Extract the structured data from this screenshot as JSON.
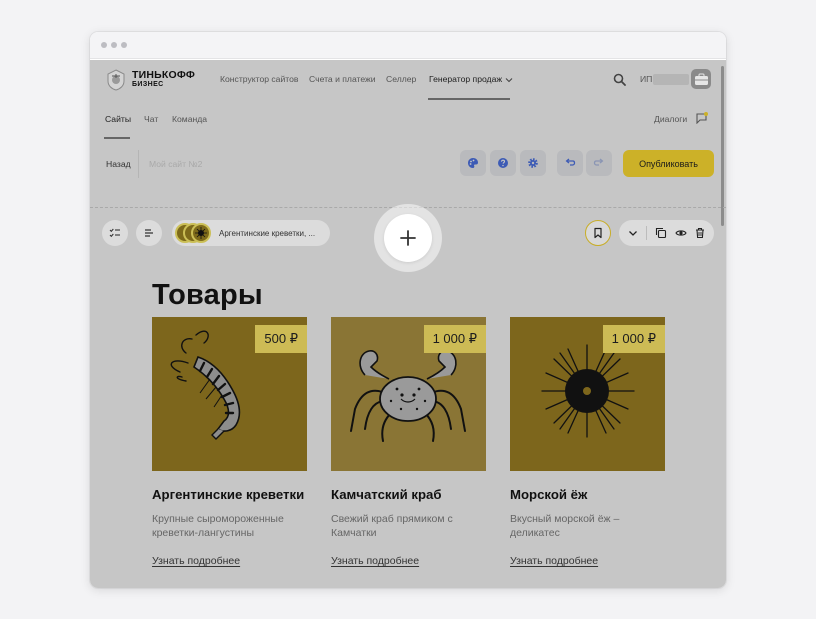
{
  "brand": {
    "name": "ТИНЬКОФФ",
    "sub": "БИЗНЕС"
  },
  "nav": {
    "items": [
      "Конструктор сайтов",
      "Счета и платежи",
      "Селлер",
      "Генератор продаж"
    ],
    "user_prefix": "ИП"
  },
  "subnav": {
    "items": [
      "Сайты",
      "Чат",
      "Команда"
    ],
    "dialogs": "Диалоги"
  },
  "editor": {
    "back_label": "Назад",
    "site_name": "Мой сайт №2",
    "publish_label": "Опубликовать"
  },
  "block": {
    "name": "Аргентинские креветки, ..."
  },
  "section": {
    "title": "Товары"
  },
  "products": [
    {
      "title": "Аргентинские креветки",
      "price": "500 ₽",
      "desc": "Крупные сыромороженные креветки-лангустины",
      "link": "Узнать подробнее",
      "image": "shrimp"
    },
    {
      "title": "Камчатский краб",
      "price": "1 000 ₽",
      "desc": "Свежий краб прямиком с Камчатки",
      "link": "Узнать подробнее",
      "image": "crab"
    },
    {
      "title": "Морской ёж",
      "price": "1 000 ₽",
      "desc": "Вкусный морской ёж – деликатес",
      "link": "Узнать подробнее",
      "image": "sea-urchin"
    }
  ],
  "colors": {
    "accent": "#ccb128",
    "overlay": "#c6c6c6",
    "card_bg": "#7d661c",
    "price_bg": "#cdbb55",
    "icon_blue": "#3d5bb5"
  }
}
